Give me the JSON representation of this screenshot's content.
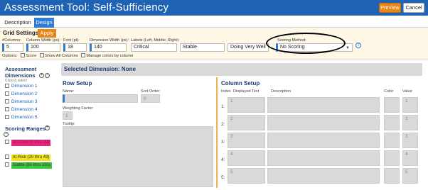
{
  "window": {
    "title": "Assessment Tool: Self-Sufficiency",
    "preview_label": "Preview",
    "cancel_label": "Cancel"
  },
  "tabs": [
    {
      "label": "Description",
      "active": false
    },
    {
      "label": "Design",
      "active": true
    }
  ],
  "grid_settings": {
    "title": "Grid Settings",
    "apply_label": "Apply",
    "columns_label": "#Columns:",
    "columns_value": "5",
    "column_width_label": "Column Width (px):",
    "column_width_value": "100",
    "font_label": "Font (pt):",
    "font_value": "18",
    "dimension_width_label": "Dimension Width (px):",
    "dimension_width_value": "140",
    "labels_label": "Labels (Left, Middle, Right):",
    "label_left": "Critical",
    "label_middle": "Stable",
    "label_right": "Doing Very Well",
    "scoring_method_label": "Scoring Method:",
    "scoring_method_value": "No Scoring",
    "help_icon": "?",
    "options_label": "Options:",
    "option_score": "Score",
    "option_show_all": "Show All Columns",
    "option_manage_colors": "Manage colors by column"
  },
  "left_panel": {
    "dimensions_title": "Assessment Dimensions",
    "dimensions_hidden_hint": "Click to select",
    "dimensions": [
      "Dimension 1",
      "Dimension 2",
      "Dimension 3",
      "Dimension 4",
      "Dimension 5"
    ],
    "scoring_ranges_title": "Scoring Ranges",
    "ranges": [
      {
        "label": "At Crisis (0 thru 19)",
        "color": "#e0297a"
      },
      {
        "label": "At Risk (20 thru 49)",
        "color": "#f2e21a"
      },
      {
        "label": "Stable (50 thru 100)",
        "color": "#3fc43f"
      }
    ]
  },
  "selected_dimension": "Selected Dimension: None",
  "row_setup": {
    "title": "Row Setup",
    "name_label": "Name:",
    "sort_order_label": "Sort Order:",
    "sort_order_value": "0",
    "weighting_label": "Weighting Factor:",
    "weighting_value": "1",
    "tooltip_label": "Tooltip:"
  },
  "column_setup": {
    "title": "Column Setup",
    "headers": {
      "index": "Index",
      "displayed_text": "Displayed Text",
      "description": "Description",
      "color": "Color",
      "value": "Value"
    },
    "rows": [
      {
        "index": "1:",
        "text": "1",
        "value": "1"
      },
      {
        "index": "2:",
        "text": "2",
        "value": "2"
      },
      {
        "index": "3:",
        "text": "3",
        "value": "3"
      },
      {
        "index": "4:",
        "text": "4",
        "value": "4"
      },
      {
        "index": "5:",
        "text": "5",
        "value": "5"
      }
    ]
  }
}
